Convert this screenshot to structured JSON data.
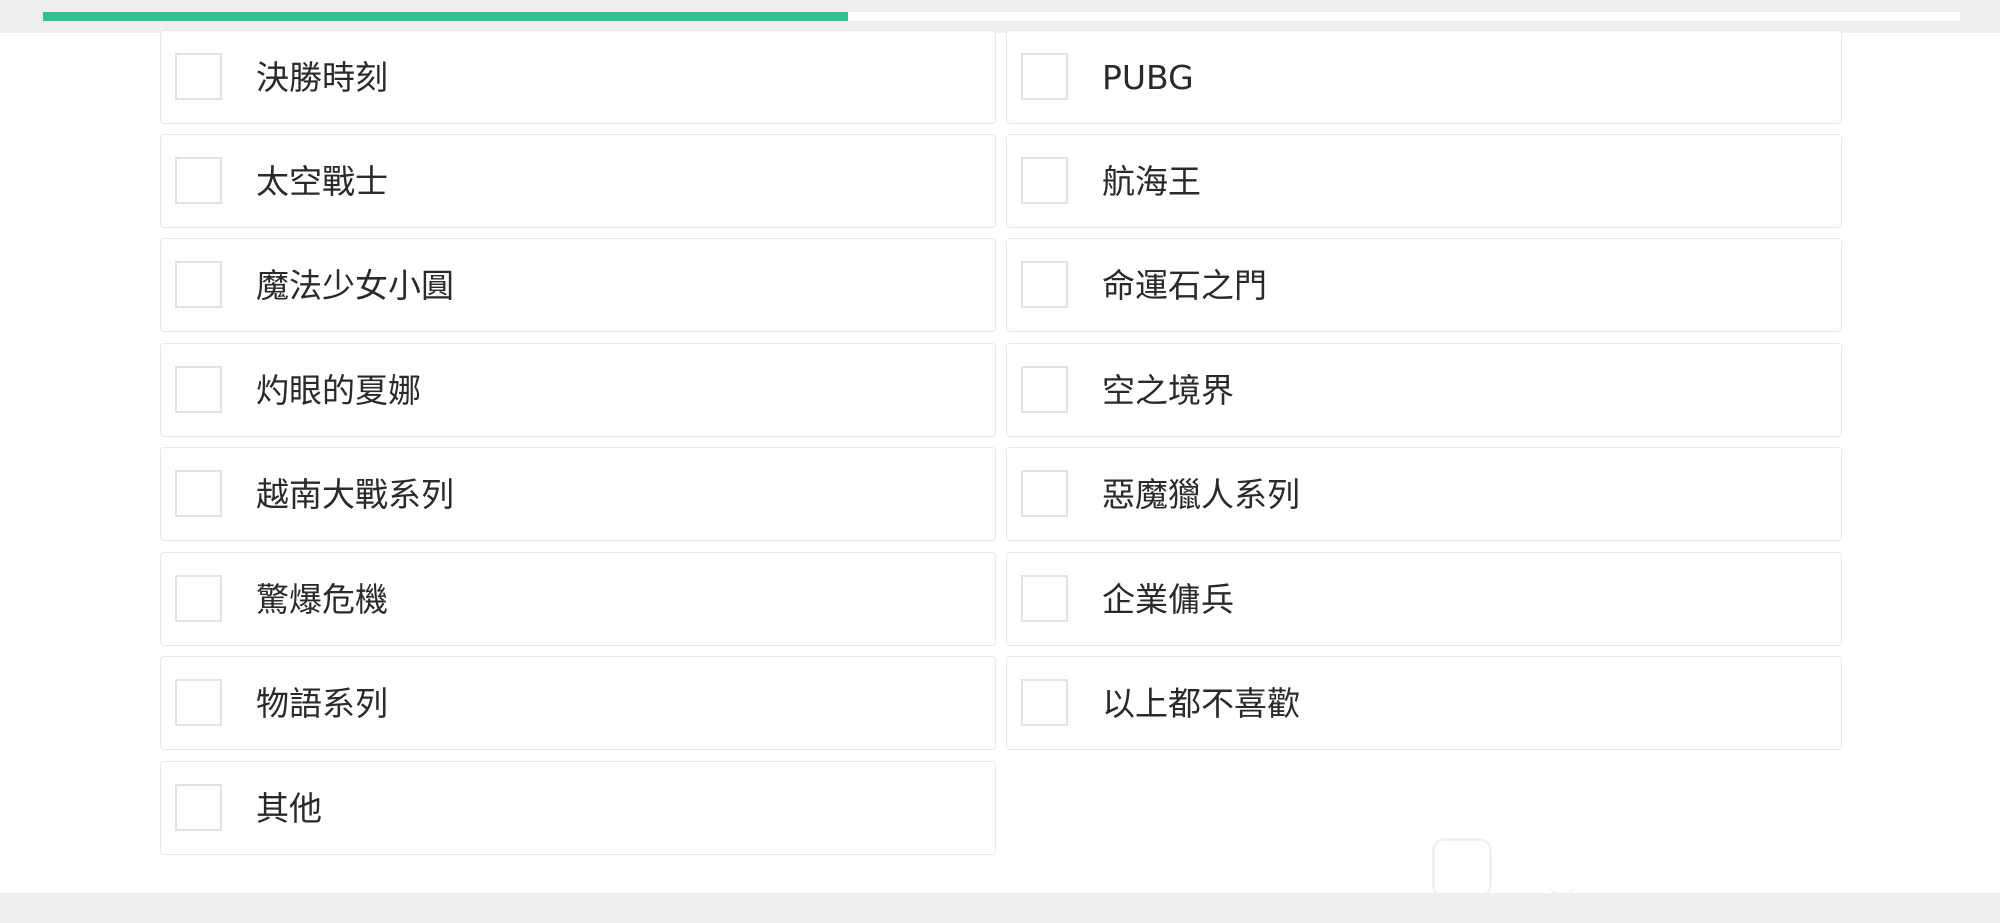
{
  "progress": {
    "value": 0.42,
    "fill_color": "#2ec28e"
  },
  "options": [
    {
      "label": "決勝時刻",
      "checked": false
    },
    {
      "label": "PUBG",
      "checked": false
    },
    {
      "label": "太空戰士",
      "checked": false
    },
    {
      "label": "航海王",
      "checked": false
    },
    {
      "label": "魔法少女小圓",
      "checked": false
    },
    {
      "label": "命運石之門",
      "checked": false
    },
    {
      "label": "灼眼的夏娜",
      "checked": false
    },
    {
      "label": "空之境界",
      "checked": false
    },
    {
      "label": "越南大戰系列",
      "checked": false
    },
    {
      "label": "惡魔獵人系列",
      "checked": false
    },
    {
      "label": "驚爆危機",
      "checked": false
    },
    {
      "label": "企業傭兵",
      "checked": false
    },
    {
      "label": "物語系列",
      "checked": false
    },
    {
      "label": "以上都不喜歡",
      "checked": false
    },
    {
      "label": "其他",
      "checked": false
    }
  ]
}
